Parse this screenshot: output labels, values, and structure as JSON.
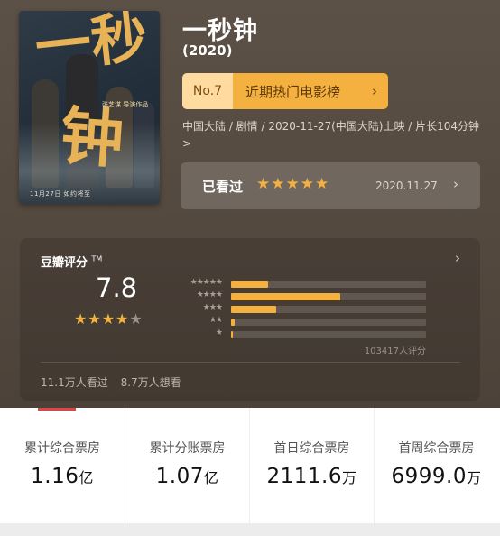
{
  "movie": {
    "title": "一秒钟",
    "year": "(2020)",
    "meta": "中国大陆 / 剧情 / 2020-11-27(中国大陆)上映 / 片长104分钟 >",
    "poster": {
      "glyph_top": "一秒",
      "glyph_bottom": "钟",
      "credit": "张艺谋 导演作品",
      "date": "11月27日 如约将至"
    }
  },
  "ranking": {
    "number": "No.7",
    "label": "近期热门电影榜",
    "chevron": "›"
  },
  "watched": {
    "label": "已看过",
    "stars": "★★★★★",
    "date": "2020.11.27",
    "chevron": "›"
  },
  "rating": {
    "header": "豆瓣评分",
    "tm": "TM",
    "chevron": "›",
    "score": "7.8",
    "stars_on": "★★★★",
    "stars_off": "★",
    "distribution": [
      {
        "stars": "★★★★★",
        "level": 0.19
      },
      {
        "stars": "★★★★",
        "level": 0.56
      },
      {
        "stars": "★★★",
        "level": 0.23
      },
      {
        "stars": "★★",
        "level": 0.02
      },
      {
        "stars": "★",
        "level": 0.01
      }
    ],
    "count": "103417人评分",
    "seen": "11.1万人看过",
    "want": "8.7万人想看"
  },
  "box_office": [
    {
      "label": "累计综合票房",
      "value": "1.16",
      "unit": "亿"
    },
    {
      "label": "累计分账票房",
      "value": "1.07",
      "unit": "亿"
    },
    {
      "label": "首日综合票房",
      "value": "2111.6",
      "unit": "万"
    },
    {
      "label": "首周综合票房",
      "value": "6999.0",
      "unit": "万"
    }
  ],
  "colors": {
    "accent": "#f4b13f",
    "background": "#54493f",
    "tab_indicator": "#e04545"
  }
}
